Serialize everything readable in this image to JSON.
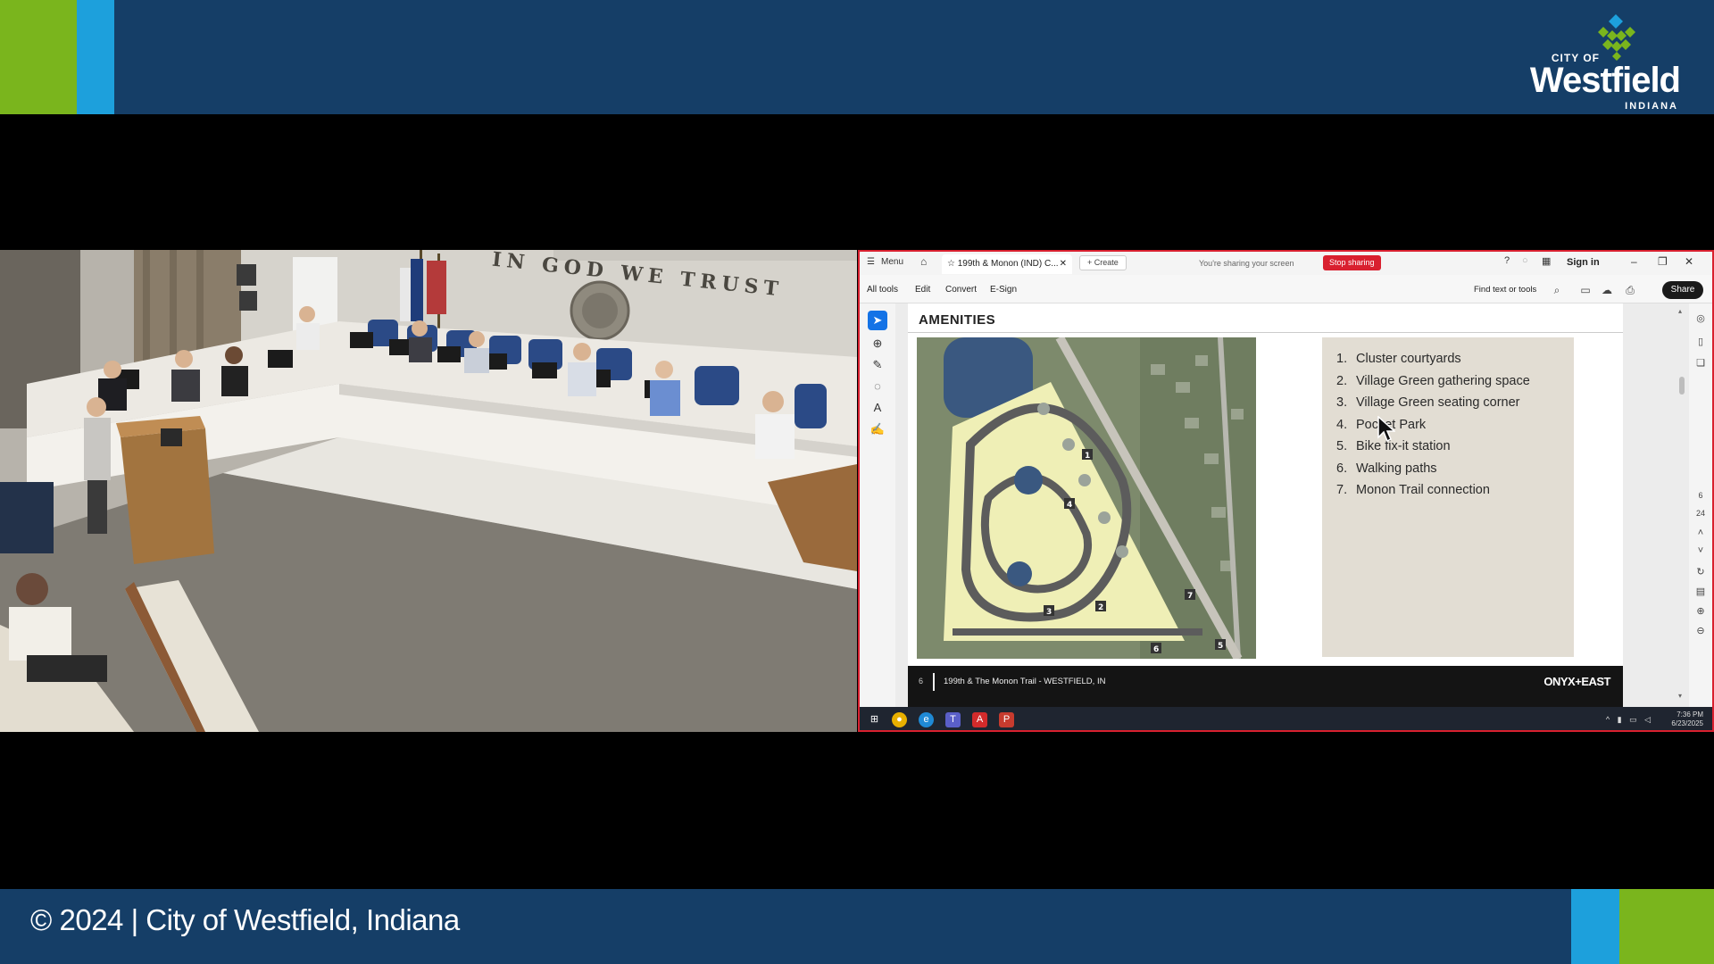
{
  "banner": {
    "logo": {
      "city_of": "CITY OF",
      "name": "Westfield",
      "state": "INDIANA"
    },
    "colors": {
      "navy": "#153e67",
      "green": "#7ab51d",
      "blue": "#1da0dc"
    }
  },
  "footer": {
    "copyright": "© 2024 | City of Westfield, Indiana"
  },
  "camera": {
    "wall_inscription": "IN GOD WE TRUST"
  },
  "screen_share": {
    "titlebar": {
      "menu_label": "Menu",
      "tab_label": "199th & Monon (IND) C...",
      "create_label": "Create",
      "sharing_status": "You're sharing your screen",
      "stop_sharing_label": "Stop sharing",
      "sign_in_label": "Sign in"
    },
    "toolbar": {
      "menus": [
        "All tools",
        "Edit",
        "Convert",
        "E-Sign"
      ],
      "find_label": "Find text or tools",
      "share_label": "Share"
    },
    "document": {
      "title": "AMENITIES",
      "amenities": [
        {
          "num": "1.",
          "label": "Cluster courtyards"
        },
        {
          "num": "2.",
          "label": "Village Green gathering space"
        },
        {
          "num": "3.",
          "label": "Village Green seating corner"
        },
        {
          "num": "4.",
          "label": "Pocket Park"
        },
        {
          "num": "5.",
          "label": "Bike fix-it station"
        },
        {
          "num": "6.",
          "label": "Walking paths"
        },
        {
          "num": "7.",
          "label": "Monon Trail connection"
        }
      ],
      "site_plan_markers": [
        "1",
        "2",
        "3",
        "4",
        "5",
        "6",
        "7"
      ],
      "footer_page": "6",
      "footer_text": "199th & The Monon Trail - WESTFIELD, IN",
      "footer_brand": "ONYX+EAST"
    },
    "right_rail": {
      "page_current": "6",
      "page_total": "24"
    },
    "taskbar": {
      "time": "7:36 PM",
      "date": "6/23/2025"
    }
  }
}
